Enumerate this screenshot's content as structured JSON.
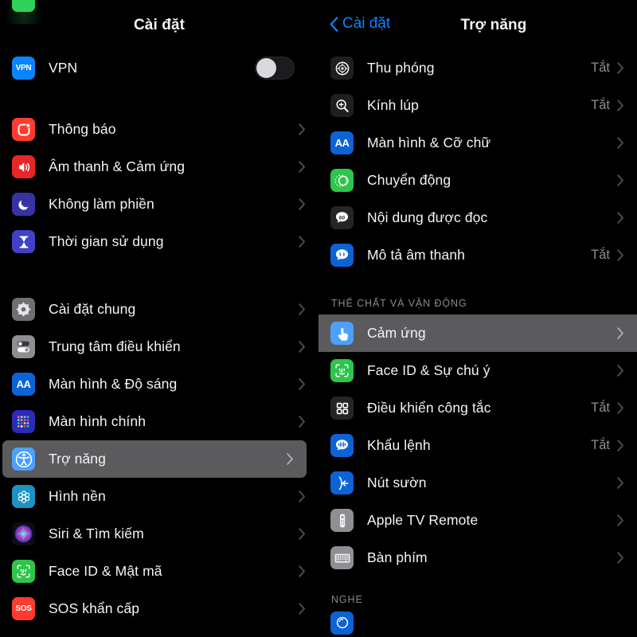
{
  "left_panel": {
    "header_title": "Cài đặt",
    "partial_top_icon": "green-app-icon",
    "groups": [
      {
        "id": "vpn-group",
        "items": [
          {
            "label": "VPN",
            "icon": "vpn-icon",
            "accessory": "toggle",
            "toggle_on": false
          }
        ]
      },
      {
        "id": "notifications-group",
        "items": [
          {
            "label": "Thông báo",
            "icon": "notifications-icon",
            "accessory": "chevron"
          },
          {
            "label": "Âm thanh & Cảm ứng",
            "icon": "sounds-haptics-icon",
            "accessory": "chevron"
          },
          {
            "label": "Không làm phiền",
            "icon": "do-not-disturb-icon",
            "accessory": "chevron"
          },
          {
            "label": "Thời gian sử dụng",
            "icon": "screen-time-icon",
            "accessory": "chevron"
          }
        ]
      },
      {
        "id": "general-group",
        "items": [
          {
            "label": "Cài đặt chung",
            "icon": "general-gear-icon",
            "accessory": "chevron"
          },
          {
            "label": "Trung tâm điều khiển",
            "icon": "control-center-icon",
            "accessory": "chevron"
          },
          {
            "label": "Màn hình & Độ sáng",
            "icon": "display-brightness-icon",
            "accessory": "chevron"
          },
          {
            "label": "Màn hình chính",
            "icon": "home-screen-icon",
            "accessory": "chevron"
          },
          {
            "label": "Trợ năng",
            "icon": "accessibility-icon",
            "accessory": "chevron",
            "selected": true
          },
          {
            "label": "Hình nền",
            "icon": "wallpaper-icon",
            "accessory": "chevron"
          },
          {
            "label": "Siri & Tìm kiếm",
            "icon": "siri-search-icon",
            "accessory": "chevron"
          },
          {
            "label": "Face ID & Mật mã",
            "icon": "face-id-icon",
            "accessory": "chevron"
          },
          {
            "label": "SOS khẩn cấp",
            "icon": "emergency-sos-icon",
            "accessory": "chevron"
          }
        ]
      }
    ]
  },
  "right_panel": {
    "back_label": "Cài đặt",
    "header_title": "Trợ năng",
    "groups": [
      {
        "id": "vision-group",
        "section_label": "",
        "items": [
          {
            "label": "Thu phóng",
            "icon": "zoom-icon",
            "value": "Tắt",
            "accessory": "chevron"
          },
          {
            "label": "Kính lúp",
            "icon": "magnifier-icon",
            "value": "Tắt",
            "accessory": "chevron"
          },
          {
            "label": "Màn hình & Cỡ chữ",
            "icon": "display-text-size-icon",
            "value": "",
            "accessory": "chevron"
          },
          {
            "label": "Chuyển động",
            "icon": "motion-icon",
            "value": "",
            "accessory": "chevron"
          },
          {
            "label": "Nội dung được đọc",
            "icon": "spoken-content-icon",
            "value": "",
            "accessory": "chevron"
          },
          {
            "label": "Mô tả âm thanh",
            "icon": "audio-descriptions-icon",
            "value": "Tắt",
            "accessory": "chevron"
          }
        ]
      },
      {
        "id": "physical-motor-group",
        "section_label": "THỂ CHẤT VÀ VẬN ĐỘNG",
        "items": [
          {
            "label": "Cảm ứng",
            "icon": "touch-icon",
            "value": "",
            "accessory": "chevron",
            "selected": true
          },
          {
            "label": "Face ID & Sự chú ý",
            "icon": "face-id-attention-icon",
            "value": "",
            "accessory": "chevron"
          },
          {
            "label": "Điều khiển công tắc",
            "icon": "switch-control-icon",
            "value": "Tắt",
            "accessory": "chevron"
          },
          {
            "label": "Khẩu lệnh",
            "icon": "voice-control-icon",
            "value": "Tắt",
            "accessory": "chevron"
          },
          {
            "label": "Nút sườn",
            "icon": "side-button-icon",
            "value": "",
            "accessory": "chevron"
          },
          {
            "label": "Apple TV Remote",
            "icon": "apple-tv-remote-icon",
            "value": "",
            "accessory": "chevron"
          },
          {
            "label": "Bàn phím",
            "icon": "keyboard-icon",
            "value": "",
            "accessory": "chevron"
          }
        ]
      },
      {
        "id": "hearing-group",
        "section_label": "NGHE",
        "items": []
      }
    ]
  },
  "colors": {
    "accent_blue": "#0a84ff",
    "selected_row": "#5b5b5e",
    "background": "#000000",
    "primary_text": "#f4f4f6",
    "secondary_text": "#8e8e93"
  }
}
